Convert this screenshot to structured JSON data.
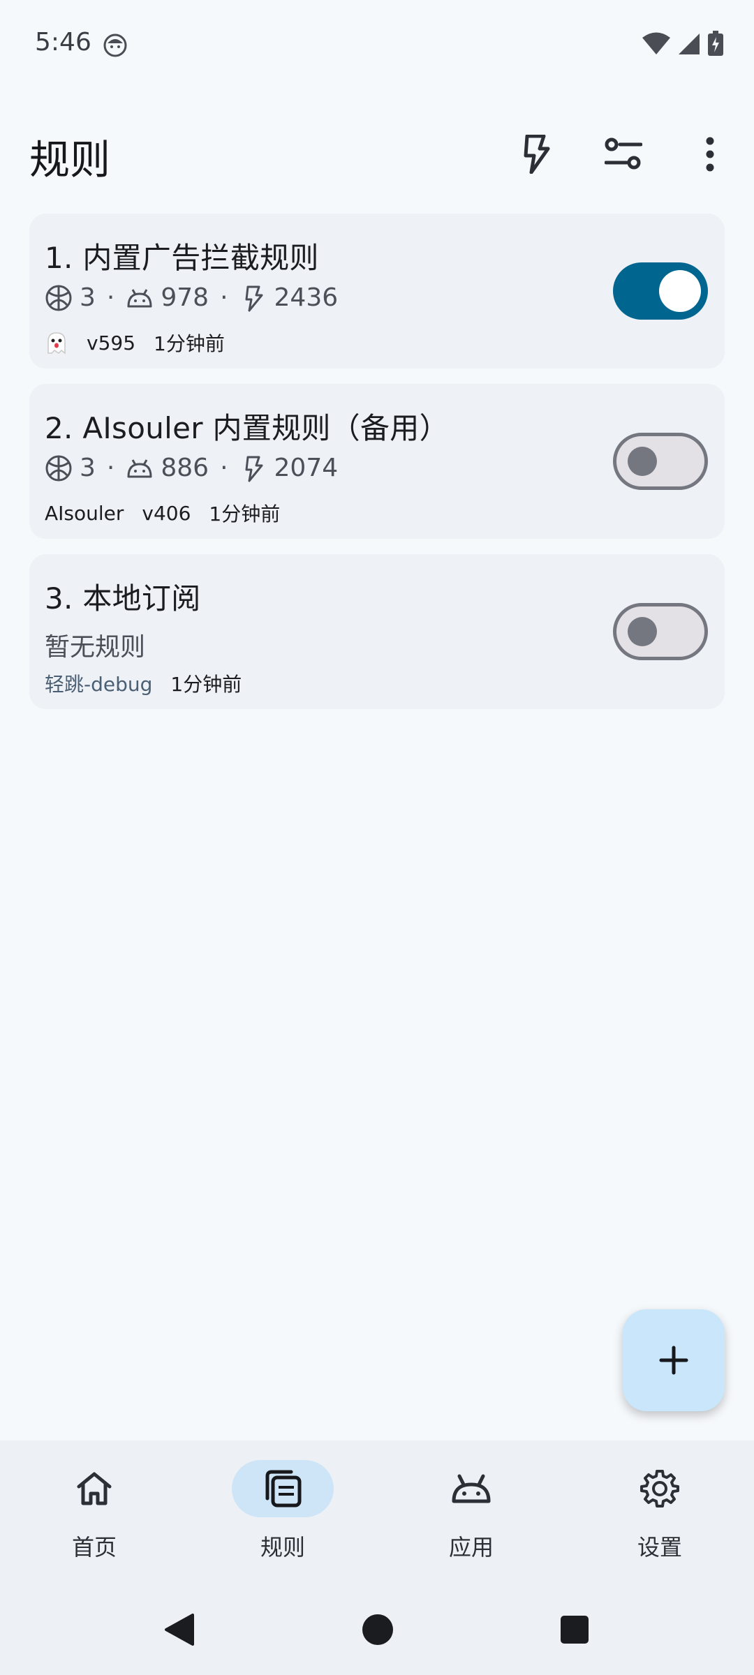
{
  "status_bar": {
    "time": "5:46"
  },
  "page": {
    "title": "规则"
  },
  "topbar": {
    "icons": [
      "flash-icon",
      "filter-sliders-icon",
      "more-vert-icon"
    ]
  },
  "rules": [
    {
      "title": "1. 内置广告拦截规则",
      "stats": {
        "globals": "3",
        "apps": "978",
        "rules": "2436"
      },
      "meta": {
        "source": "",
        "version": "v595",
        "time": "1分钟前"
      },
      "enabled": true
    },
    {
      "title": "2. AIsouler 内置规则（备用）",
      "stats": {
        "globals": "3",
        "apps": "886",
        "rules": "2074"
      },
      "meta": {
        "source": "AIsouler",
        "version": "v406",
        "time": "1分钟前"
      },
      "enabled": false
    },
    {
      "title": "3. 本地订阅",
      "empty": "暂无规则",
      "meta": {
        "source": "轻跳-debug",
        "time": "1分钟前"
      },
      "enabled": false
    }
  ],
  "separator": "·",
  "fab": {
    "icon": "add-icon"
  },
  "bottom_nav": {
    "items": [
      {
        "label": "首页",
        "icon": "home-icon",
        "active": false
      },
      {
        "label": "规则",
        "icon": "rules-icon",
        "active": true
      },
      {
        "label": "应用",
        "icon": "android-icon",
        "active": false
      },
      {
        "label": "设置",
        "icon": "gear-icon",
        "active": false
      }
    ]
  },
  "colors": {
    "accent": "#00658f",
    "card": "#eef1f5",
    "fab": "#c9e6fb",
    "nav_active": "#cde5f6"
  }
}
